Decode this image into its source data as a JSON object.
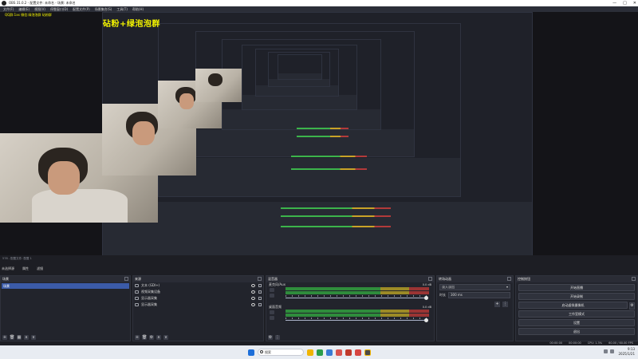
{
  "window": {
    "title": "OBS 31.0.2 - 配置文件: 未命名 - 场景: 未命名",
    "controls": [
      "—",
      "□",
      "✕"
    ]
  },
  "menu": [
    "文件(F)",
    "编辑(E)",
    "视图(V)",
    "停靠窗口(D)",
    "配置文件(P)",
    "场景集合(S)",
    "工具(T)",
    "帮助(H)"
  ],
  "preview": {
    "overlay_title": "砧粉+绿泡泡群",
    "overlay_small": "QQ群:1xx  微信:绿泡泡群  砧粉群"
  },
  "preview_info": "578 - 配置文件: 配置 1",
  "scene_bar": [
    "未选择源",
    "属性",
    "滤镜"
  ],
  "scenes": {
    "header": "场景",
    "items": [
      "场景"
    ],
    "footer_buttons": [
      "+",
      "🗑",
      "▦",
      "∧",
      "∨"
    ]
  },
  "sources": {
    "header": "来源",
    "items": [
      {
        "name": "文本 (GDI+)",
        "icon": "text-icon"
      },
      {
        "name": "视频采集设备",
        "icon": "camera-icon"
      },
      {
        "name": "显示器采集",
        "icon": "monitor-icon"
      },
      {
        "name": "显示器采集",
        "icon": "monitor-icon"
      }
    ],
    "footer_buttons": [
      "+",
      "🗑",
      "⚙",
      "∧",
      "∨"
    ]
  },
  "mixer": {
    "header": "混音器",
    "tracks": [
      {
        "name": "麦克风/Aux",
        "db": "0.0 dB"
      },
      {
        "name": "桌面音频",
        "db": "0.0 dB"
      }
    ],
    "scale": [
      "-60",
      "-55",
      "-50",
      "-45",
      "-40",
      "-35",
      "-30",
      "-25",
      "-20",
      "-15",
      "-10",
      "-5",
      "0"
    ]
  },
  "transitions": {
    "header": "转场动画",
    "selected": "淡入淡出",
    "duration_label": "时长",
    "duration_value": "300 ms"
  },
  "controls": {
    "header": "控制按钮",
    "buttons": [
      "开始直播",
      "开始录制",
      "启动虚拟摄像机",
      "工作室模式",
      "设置",
      "退出"
    ]
  },
  "status": {
    "rec": "00:00:00",
    "stream": "00:00:00",
    "cpu": "CPU: 1.3%",
    "fps": "60.00 / 60.00 FPS"
  },
  "taskbar": {
    "search_placeholder": "搜索",
    "time": "9:13",
    "date": "2025/1/21",
    "icon_colors": [
      "#1e6fd9",
      "#f0b400",
      "#2a9d4a",
      "#d9534f",
      "#3a7bd5",
      "#c0392b",
      "#d64541",
      "#4a4a4a"
    ]
  },
  "colors": {
    "accent": "#3b5ba8",
    "overlay": "#f5f500",
    "meter_green": "#2f8c3c",
    "meter_yellow": "#9c8a26",
    "meter_red": "#9a3434"
  }
}
